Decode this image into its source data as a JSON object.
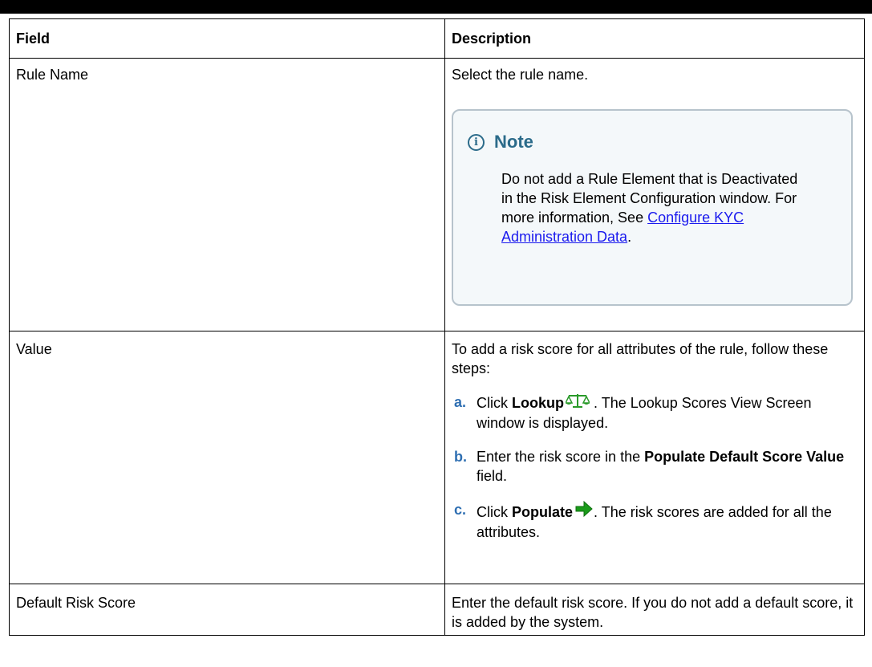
{
  "table": {
    "headers": {
      "field": "Field",
      "description": "Description"
    },
    "rows": {
      "rule_name": {
        "field": "Rule Name",
        "description": "Select the rule name.",
        "note": {
          "icon": "info-icon",
          "title": "Note",
          "text": "Do not add a Rule Element that is Deactivated in the Risk Element Configuration window. For more information, See ",
          "link": "Configure KYC Administration Data",
          "after_link": "."
        }
      },
      "value": {
        "field": "Value",
        "intro": "To add a risk score for all attributes of the rule, follow these steps:",
        "steps": [
          {
            "label": "a.",
            "pre": "Click ",
            "bold": "Lookup",
            "icon": "balance-scale-icon",
            "post": ". The Lookup Scores View Screen window is displayed."
          },
          {
            "label": "b.",
            "pre": "Enter the risk score in the ",
            "bold": "Populate Default Score Value",
            "post": " field."
          },
          {
            "label": "c.",
            "pre": "Click ",
            "bold": "Populate",
            "icon": "green-arrow-icon",
            "post": ". The risk scores are added for all the attributes."
          }
        ]
      },
      "default_risk_score": {
        "field": "Default Risk Score",
        "description": "Enter the default risk score. If you do not add a default score, it is added by the system."
      }
    }
  },
  "colors": {
    "note_title": "#2b6b8a",
    "step_label": "#2f6fb2",
    "link": "#1a1aee",
    "arrow": "#1a9b1a",
    "scale": "#2a9a2a"
  }
}
